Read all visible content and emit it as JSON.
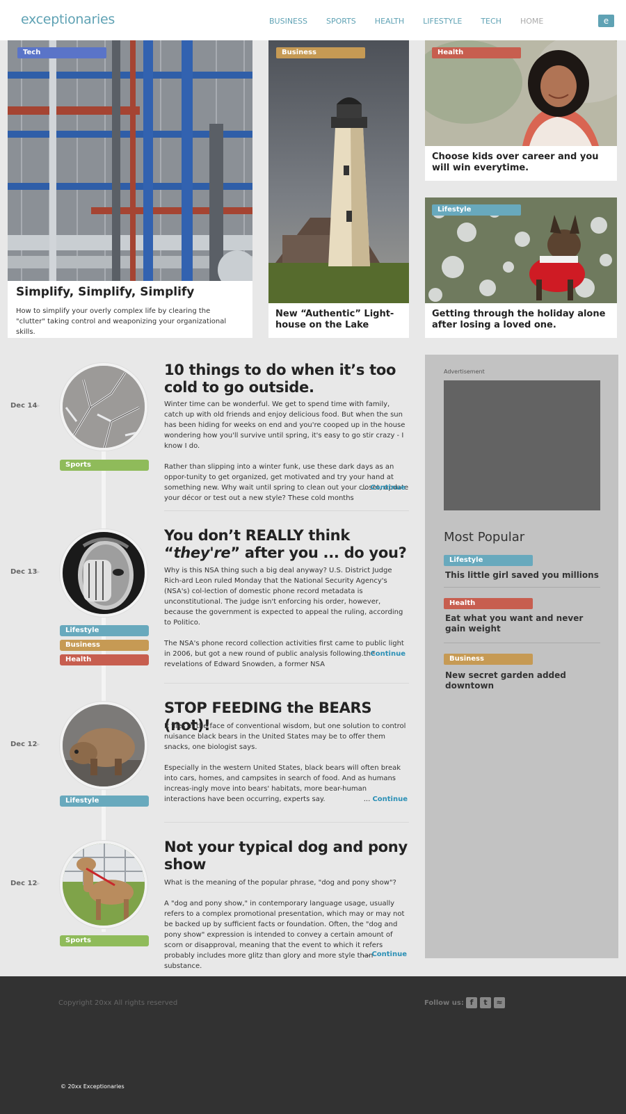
{
  "header": {
    "logo": "exceptionaries",
    "nav": [
      "BUSINESS",
      "SPORTS",
      "HEALTH",
      "LIFESTYLE",
      "TECH",
      "HOME"
    ],
    "icon": "e"
  },
  "colors": {
    "tech": "#5a74c8",
    "business": "#c69a54",
    "health": "#c75e4f",
    "lifestyle": "#68a9bd",
    "sports": "#8fbb5a",
    "link": "#2a8fb5"
  },
  "featured": [
    {
      "tag": "Tech",
      "title": "Simplify, Simplify, Simplify",
      "desc": "How to simplify your overly complex life by clearing the \"clutter\" taking control and weaponizing your organizational skills."
    },
    {
      "tag": "Business",
      "title": "New “Authentic” Light-house on the Lake"
    },
    {
      "tag": "Health",
      "title": "Choose kids over career and you will win everytime."
    },
    {
      "tag": "Lifestyle",
      "title": "Getting through the holiday alone after losing a loved one."
    }
  ],
  "posts": [
    {
      "date": "Dec 14",
      "tags": [
        "Sports"
      ],
      "title": "10 things to do when it’s too cold to go outside.",
      "p1": "Winter time can be wonderful. We get to spend time with family, catch up with old friends and enjoy delicious food. But when the sun has been hiding for weeks on end and you're cooped up in the house wondering how you'll survive until spring, it's easy to go stir crazy - I know I do.",
      "p2": "Rather than slipping into a winter funk, use these dark days as an oppor-tunity to get organized, get motivated and try your hand at something new. Why wait until spring to clean out your closet, update your décor or test out a new style? These cold months"
    },
    {
      "date": "Dec 13",
      "tags": [
        "Lifestyle",
        "Business",
        "Health"
      ],
      "title_a": "You don’t REALLY think “",
      "title_em": "they're",
      "title_b": "” after you ... do you?",
      "p1": "Why is this NSA thing such a big deal anyway? U.S. District Judge Rich-ard Leon ruled Monday that the National Security Agency's (NSA's) col-lection of domestic phone record metadata is unconstitutional. The judge isn't enforcing his order, however, because the government is expected to appeal the ruling, according to Politico.",
      "p2": "The NSA's phone record collection activities first came to public light in 2006, but got a new round of public analysis following the revelations of Edward Snowden, a former NSA"
    },
    {
      "date": "Dec 12",
      "tags": [
        "Lifestyle"
      ],
      "title": "STOP FEEDING the BEARS (not)!",
      "p1": "It flies in the face of conventional wisdom, but one solution to control nuisance black bears in the United States may be to offer them snacks, one biologist says.",
      "p2": "Especially in the western United States, black bears will often break into cars, homes, and campsites in search of food. And as humans increas-ingly move into bears' habitats, more bear-human interactions have been occurring, experts say."
    },
    {
      "date": "Dec 12",
      "tags": [
        "Sports"
      ],
      "title": "Not your typical dog and pony show",
      "p1": "What is the meaning of the popular phrase, \"dog and pony show\"?",
      "p2": "A \"dog and pony show,\" in contemporary language usage, usually refers to a complex promotional presentation, which may or may not be backed up by sufficient facts or foundation. Often, the \"dog and pony show\" expression is intended to convey a certain amount of scorn or disapproval, meaning that the event to which it refers probably includes more glitz than glory and more style than substance."
    }
  ],
  "continue": {
    "dots": "... ",
    "label": "Continue"
  },
  "sidebar": {
    "ad_label": "Advertisement",
    "most_popular": "Most Popular",
    "items": [
      {
        "tag": "Lifestyle",
        "title": "This little girl saved you millions"
      },
      {
        "tag": "Health",
        "title": "Eat what you want and never gain weight"
      },
      {
        "tag": "Business",
        "title": "New secret garden added downtown"
      }
    ]
  },
  "footer": {
    "copyright": "Copyright 20xx All rights reserved",
    "follow": "Follow us:",
    "social": [
      "facebook-icon",
      "twitter-icon",
      "rss-icon"
    ],
    "brand": "© 20xx Exceptionaries"
  }
}
